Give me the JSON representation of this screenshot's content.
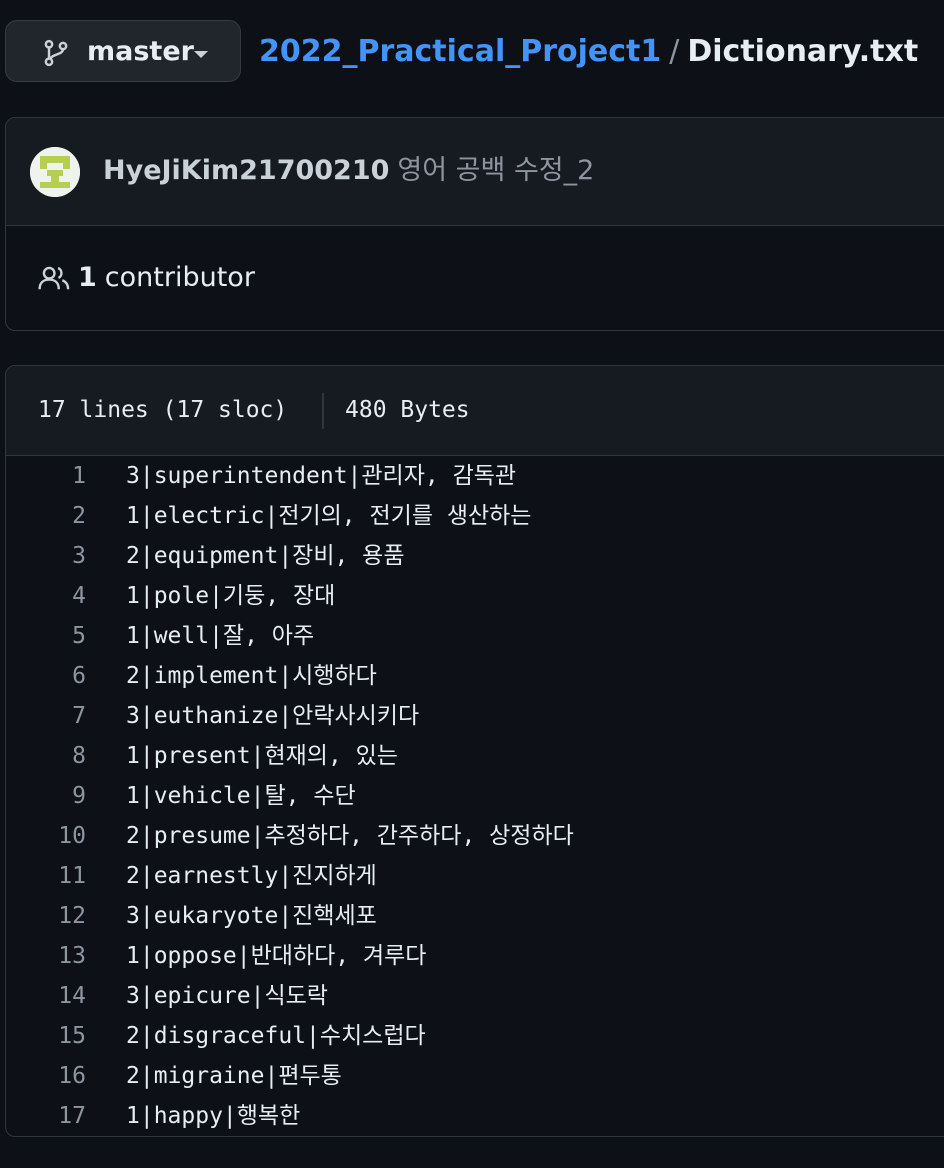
{
  "branch": {
    "name": "master",
    "icon": "git-branch-icon"
  },
  "breadcrumb": {
    "repo": "2022_Practical_Project1",
    "separator": "/",
    "file": "Dictionary.txt"
  },
  "commit": {
    "author": "HyeJiKim21700210",
    "message": "영어 공백 수정_2",
    "avatar_icon": "identicon-avatar"
  },
  "contributors": {
    "icon": "people-icon",
    "count": "1",
    "label": "contributor"
  },
  "file_info": {
    "lines": "17 lines (17 sloc)",
    "size": "480 Bytes"
  },
  "code_lines": [
    {
      "n": "1",
      "text": "3|superintendent|관리자, 감독관"
    },
    {
      "n": "2",
      "text": "1|electric|전기의, 전기를 생산하는"
    },
    {
      "n": "3",
      "text": "2|equipment|장비, 용품"
    },
    {
      "n": "4",
      "text": "1|pole|기둥, 장대"
    },
    {
      "n": "5",
      "text": "1|well|잘, 아주"
    },
    {
      "n": "6",
      "text": "2|implement|시행하다"
    },
    {
      "n": "7",
      "text": "3|euthanize|안락사시키다"
    },
    {
      "n": "8",
      "text": "1|present|현재의, 있는"
    },
    {
      "n": "9",
      "text": "1|vehicle|탈, 수단"
    },
    {
      "n": "10",
      "text": "2|presume|추정하다, 간주하다, 상정하다"
    },
    {
      "n": "11",
      "text": "2|earnestly|진지하게"
    },
    {
      "n": "12",
      "text": "3|eukaryote|진핵세포"
    },
    {
      "n": "13",
      "text": "1|oppose|반대하다, 겨루다"
    },
    {
      "n": "14",
      "text": "3|epicure|식도락"
    },
    {
      "n": "15",
      "text": "2|disgraceful|수치스럽다"
    },
    {
      "n": "16",
      "text": "2|migraine|편두통"
    },
    {
      "n": "17",
      "text": "1|happy|행복한"
    }
  ],
  "colors": {
    "background": "#0d1117",
    "link": "#4493f8",
    "muted": "#8d96a0",
    "border": "#30363d"
  }
}
